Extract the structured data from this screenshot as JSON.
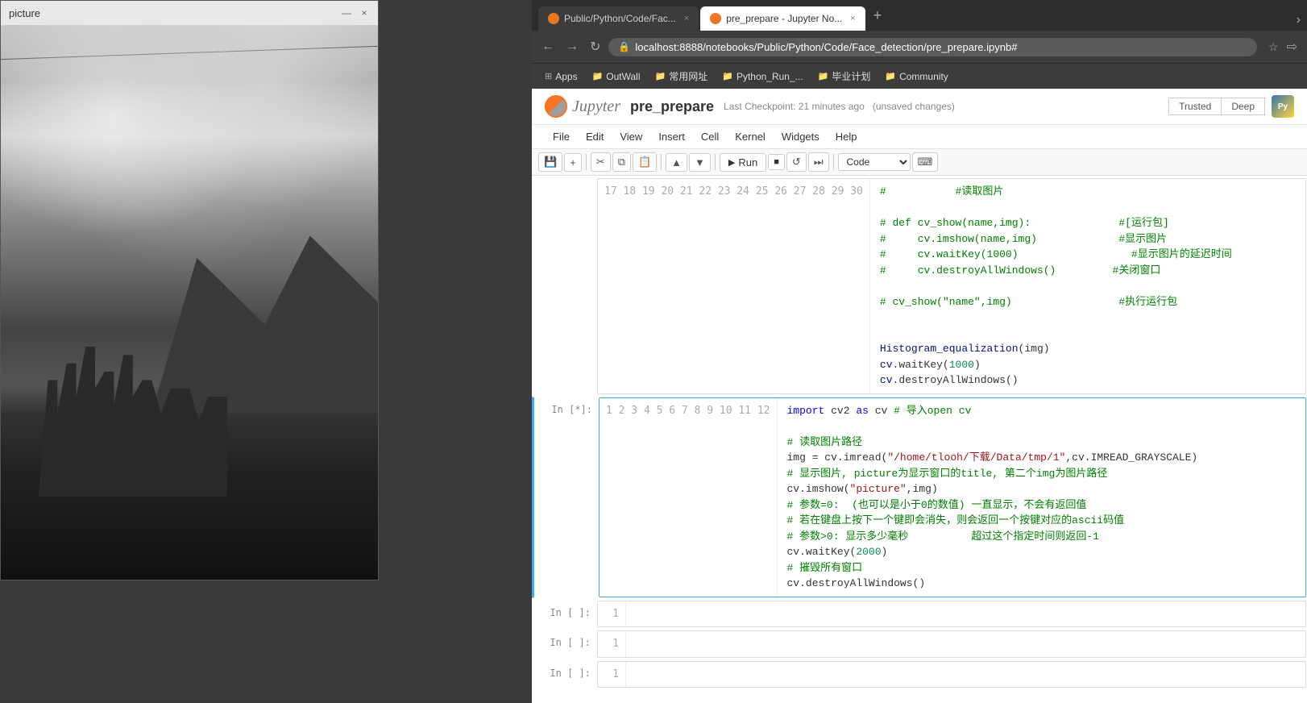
{
  "picture_window": {
    "title": "picture",
    "close_btn": "×",
    "minimize_btn": "—"
  },
  "browser": {
    "tabs": [
      {
        "id": "tab1",
        "label": "Public/Python/Code/Fac...",
        "active": false,
        "favicon_type": "orange"
      },
      {
        "id": "tab2",
        "label": "pre_prepare - Jupyter No...",
        "active": true,
        "favicon_type": "jupyter"
      }
    ],
    "url": "localhost:8888/notebooks/Public/Python/Code/Face_detection/pre_prepare.ipynb#",
    "bookmarks": [
      {
        "label": "Apps",
        "icon": "⊞"
      },
      {
        "label": "OutWall",
        "icon": "📁"
      },
      {
        "label": "常用网址",
        "icon": "📁"
      },
      {
        "label": "Python_Run_...",
        "icon": "📁"
      },
      {
        "label": "毕业计划",
        "icon": "📁"
      },
      {
        "label": "Community",
        "icon": "📁"
      }
    ]
  },
  "jupyter": {
    "logo_text": "Jupyter",
    "notebook_name": "pre_prepare",
    "checkpoint_text": "Last Checkpoint: 21 minutes ago",
    "unsaved_text": "(unsaved changes)",
    "menu_items": [
      "File",
      "Edit",
      "View",
      "Insert",
      "Cell",
      "Kernel",
      "Widgets",
      "Help"
    ],
    "toolbar": {
      "run_label": "Run",
      "kernel_select": "Code"
    },
    "trusted_btn": "Trusted",
    "deep_btn": "Deep",
    "cells": [
      {
        "label": "",
        "type": "code",
        "lines": [
          {
            "num": 17,
            "code": "#           #读取图片"
          },
          {
            "num": 18,
            "code": ""
          },
          {
            "num": 19,
            "code": "# def cv_show(name,img):              #[运行包]"
          },
          {
            "num": 20,
            "code": "#     cv.imshow(name,img)             #显示图片"
          },
          {
            "num": 21,
            "code": "#     cv.waitKey(1000)                  #显示图片的延迟时间"
          },
          {
            "num": 22,
            "code": "#     cv.destroyAllWindows()         #关闭窗口"
          },
          {
            "num": 23,
            "code": ""
          },
          {
            "num": 24,
            "code": "# cv_show(\"name\",img)                 #执行运行包"
          },
          {
            "num": 25,
            "code": ""
          },
          {
            "num": 26,
            "code": ""
          },
          {
            "num": 27,
            "code": "Histogram_equalization(img)"
          },
          {
            "num": 28,
            "code": "cv.waitKey(1000)"
          },
          {
            "num": 29,
            "code": "cv.destroyAllWindows()"
          },
          {
            "num": 30,
            "code": ""
          }
        ]
      },
      {
        "label": "In [*]:",
        "type": "code",
        "active": true,
        "lines": [
          {
            "num": 1,
            "code": "import cv2 as cv # 导入open cv"
          },
          {
            "num": 2,
            "code": ""
          },
          {
            "num": 3,
            "code": "# 读取图片路径"
          },
          {
            "num": 4,
            "code": "img = cv.imread(\"/home/tlooh/下载/Data/tmp/1\",cv.IMREAD_GRAYSCALE)"
          },
          {
            "num": 5,
            "code": "# 显示图片, picture为显示窗口的title, 第二个img为图片路径"
          },
          {
            "num": 6,
            "code": "cv.imshow(\"picture\",img)"
          },
          {
            "num": 7,
            "code": "# 参数=0:  (也可以是小于0的数值) 一直显示，不会有返回值"
          },
          {
            "num": 8,
            "code": "# 若在键盘上按下一个键即会消失，则会返回一个按键对应的ascii码值"
          },
          {
            "num": 9,
            "code": "# 参数>0: 显示多少毫秒          超过这个指定时间则返回-1"
          },
          {
            "num": 10,
            "code": "cv.waitKey(2000)"
          },
          {
            "num": 11,
            "code": "# 摧毁所有窗口"
          },
          {
            "num": 12,
            "code": "cv.destroyAllWindows()"
          }
        ]
      },
      {
        "label": "In [ ]:",
        "type": "code",
        "empty": true,
        "lines": [
          {
            "num": 1,
            "code": ""
          }
        ]
      },
      {
        "label": "In [ ]:",
        "type": "code",
        "empty": true,
        "lines": [
          {
            "num": 1,
            "code": ""
          }
        ]
      },
      {
        "label": "In [ ]:",
        "type": "code",
        "empty": true,
        "lines": [
          {
            "num": 1,
            "code": ""
          }
        ]
      }
    ]
  }
}
